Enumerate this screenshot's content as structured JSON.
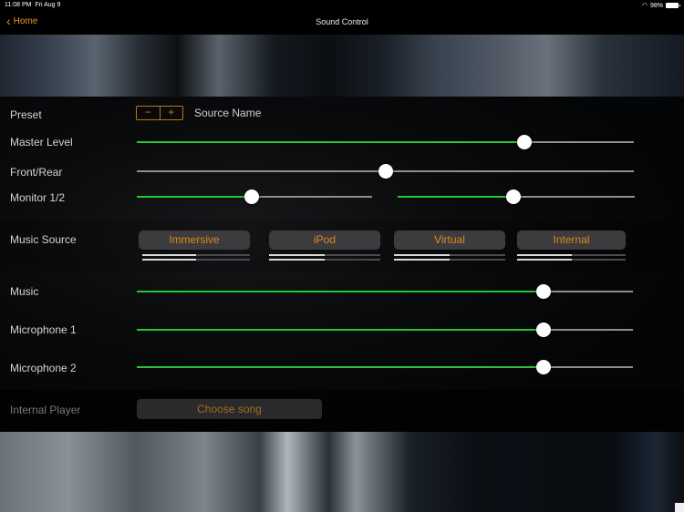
{
  "status_bar": {
    "time": "11:08 PM",
    "date": "Fri Aug 9",
    "wifi_icon": "wifi-icon",
    "battery_percent": "98%",
    "battery_level": 0.98
  },
  "nav": {
    "back_label": "Home",
    "back_icon": "chevron-left-icon",
    "title": "Sound Control"
  },
  "preset": {
    "label": "Preset",
    "minus": "−",
    "plus": "+",
    "source_name": "Source Name"
  },
  "sliders": {
    "master_level": {
      "label": "Master Level",
      "value": 0.78,
      "filled": true
    },
    "front_rear": {
      "label": "Front/Rear",
      "value": 0.5,
      "filled": false
    },
    "monitor_1": {
      "label": "Monitor 1/2",
      "value": 0.49,
      "filled": true
    },
    "monitor_2": {
      "value": 0.49,
      "filled": true
    },
    "music": {
      "label": "Music",
      "value": 0.82,
      "filled": true
    },
    "microphone_1": {
      "label": "Microphone 1",
      "value": 0.82,
      "filled": true
    },
    "microphone_2": {
      "label": "Microphone 2",
      "value": 0.82,
      "filled": true
    }
  },
  "music_source": {
    "label": "Music Source",
    "buttons": [
      {
        "label": "Immersive",
        "meter_top": 0.5,
        "meter_bottom": 0.5
      },
      {
        "label": "iPod",
        "meter_top": 0.5,
        "meter_bottom": 0.5
      },
      {
        "label": "Virtual",
        "meter_top": 0.5,
        "meter_bottom": 0.5
      },
      {
        "label": "Internal",
        "meter_top": 0.5,
        "meter_bottom": 0.5
      }
    ]
  },
  "internal_player": {
    "label": "Internal Player",
    "button_label": "Choose song"
  },
  "colors": {
    "accent": "#f0961e",
    "slider_fill": "#29c42f",
    "slider_track": "#8e8e8e"
  }
}
